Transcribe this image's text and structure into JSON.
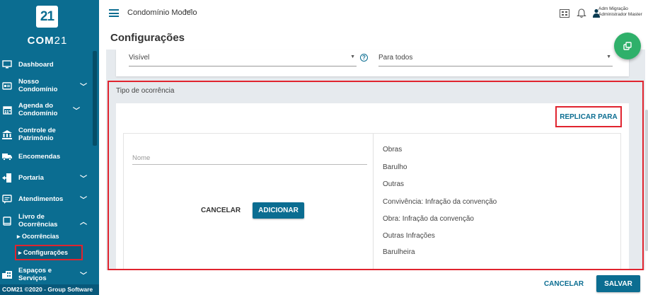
{
  "brand": {
    "logo_mark": "21",
    "logo_name_bold": "COM",
    "logo_name_thin": "21"
  },
  "sidebar": {
    "items": [
      {
        "label": "Dashboard",
        "icon": "monitor-icon"
      },
      {
        "label": "Nosso Condomínio",
        "icon": "id-card-icon",
        "chevron": "chevron-down-icon"
      },
      {
        "label": "Agenda do Condomínio",
        "icon": "calendar-icon",
        "chevron": "chevron-down-icon"
      },
      {
        "label": "Controle de Patrimônio",
        "icon": "bank-icon"
      },
      {
        "label": "Encomendas",
        "icon": "truck-icon"
      },
      {
        "label": "Portaria",
        "icon": "door-icon",
        "chevron": "chevron-down-icon"
      },
      {
        "label": "Atendimentos",
        "icon": "chat-icon",
        "chevron": "chevron-down-icon"
      },
      {
        "label": "Livro de Ocorrências",
        "icon": "book-icon",
        "chevron": "chevron-up-icon"
      },
      {
        "label": "Espaços e Serviços",
        "icon": "building-icon",
        "chevron": "chevron-down-icon"
      }
    ],
    "subitems": [
      {
        "label": "▸ Ocorrências"
      },
      {
        "label": "▸ Configurações",
        "active": true
      }
    ],
    "footer": "COM21 ©2020 - Group Software"
  },
  "topbar": {
    "condo_name": "Condomínio Modelo",
    "user_name": "Adm Migração",
    "user_role": "Administrador Master"
  },
  "page": {
    "title": "Configurações"
  },
  "visibility": {
    "left_value": "Visível",
    "right_value": "Para todos"
  },
  "occurrence_type": {
    "section_title": "Tipo de ocorrência",
    "replicate_label": "REPLICAR PARA",
    "name_placeholder": "Nome",
    "cancel_label": "CANCELAR",
    "add_label": "ADICIONAR",
    "items": [
      "Obras",
      "Barulho",
      "Outras",
      "Convivência: Infração da convenção",
      "Obra: Infração da convenção",
      "Outras Infrações",
      "Barulheira"
    ]
  },
  "footer": {
    "cancel_label": "CANCELAR",
    "save_label": "SALVAR"
  },
  "colors": {
    "primary": "#0b6d91",
    "fab": "#2fb06a",
    "highlight": "#e0242f"
  }
}
